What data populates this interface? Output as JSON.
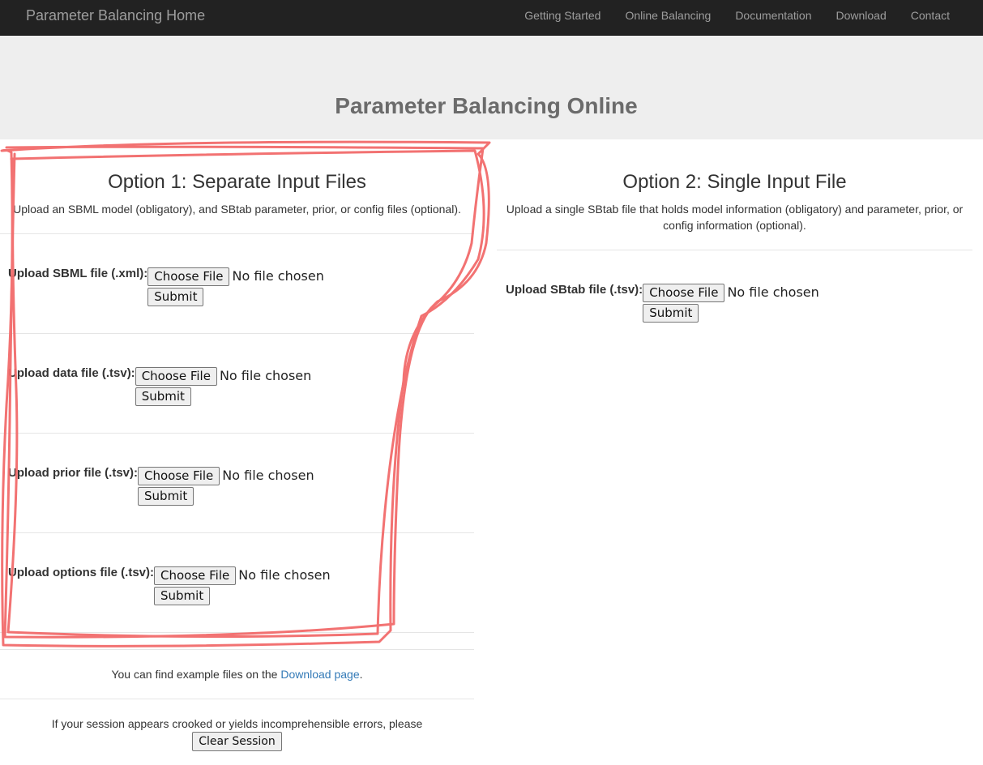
{
  "navbar": {
    "brand": "Parameter Balancing Home",
    "links": [
      "Getting Started",
      "Online Balancing",
      "Documentation",
      "Download",
      "Contact"
    ]
  },
  "page_title": "Parameter Balancing Online",
  "option1": {
    "title": "Option 1: Separate Input Files",
    "description": "Upload an SBML model (obligatory), and SBtab parameter, prior, or config files (optional).",
    "uploads": [
      {
        "label": "Upload SBML file (.xml):",
        "choose": "Choose File",
        "status": "No file chosen",
        "submit": "Submit"
      },
      {
        "label": "Upload data file (.tsv):",
        "choose": "Choose File",
        "status": "No file chosen",
        "submit": "Submit"
      },
      {
        "label": "Upload prior file (.tsv):",
        "choose": "Choose File",
        "status": "No file chosen",
        "submit": "Submit"
      },
      {
        "label": "Upload options file (.tsv):",
        "choose": "Choose File",
        "status": "No file chosen",
        "submit": "Submit"
      }
    ]
  },
  "option2": {
    "title": "Option 2: Single Input File",
    "description": "Upload a single SBtab file that holds model information (obligatory) and parameter, prior, or config information (optional).",
    "upload": {
      "label": "Upload SBtab file (.tsv):",
      "choose": "Choose File",
      "status": "No file chosen",
      "submit": "Submit"
    }
  },
  "notes": {
    "example_prefix": "You can find example files on the ",
    "example_link": "Download page",
    "example_suffix": ".",
    "session_text": "If your session appears crooked or yields incomprehensible errors, please",
    "clear_button": "Clear Session"
  },
  "colors": {
    "navbar_bg": "#222222",
    "jumbotron_bg": "#eeeeee",
    "link": "#337ab7",
    "annotation": "#f26b6b"
  }
}
